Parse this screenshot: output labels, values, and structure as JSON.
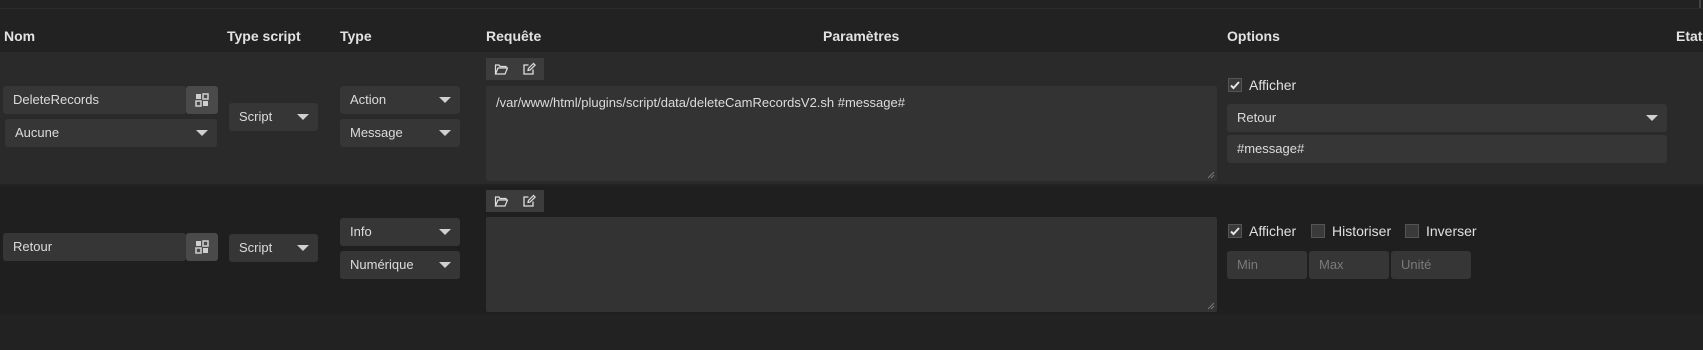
{
  "headers": {
    "nom": "Nom",
    "type_script": "Type script",
    "type": "Type",
    "requete": "Requête",
    "parametres": "Paramètres",
    "options": "Options",
    "etat": "Etat"
  },
  "rows": [
    {
      "name": "DeleteRecords",
      "sub_select": "Aucune",
      "type_script": "Script",
      "type": "Action",
      "subtype": "Message",
      "request": "/var/www/html/plugins/script/data/deleteCamRecordsV2.sh  #message#",
      "options": {
        "afficher_label": "Afficher",
        "afficher_checked": true,
        "return_select": "Retour",
        "message_value": "#message#"
      }
    },
    {
      "name": "Retour",
      "type_script": "Script",
      "type": "Info",
      "subtype": "Numérique",
      "request": "",
      "options": {
        "afficher_label": "Afficher",
        "afficher_checked": true,
        "historiser_label": "Historiser",
        "historiser_checked": false,
        "inverser_label": "Inverser",
        "inverser_checked": false,
        "min_placeholder": "Min",
        "max_placeholder": "Max",
        "unite_placeholder": "Unité"
      }
    }
  ],
  "icons": {
    "config": "gear-grid-icon",
    "open": "folder-open-icon",
    "edit": "edit-icon",
    "check": "checkmark-icon"
  }
}
